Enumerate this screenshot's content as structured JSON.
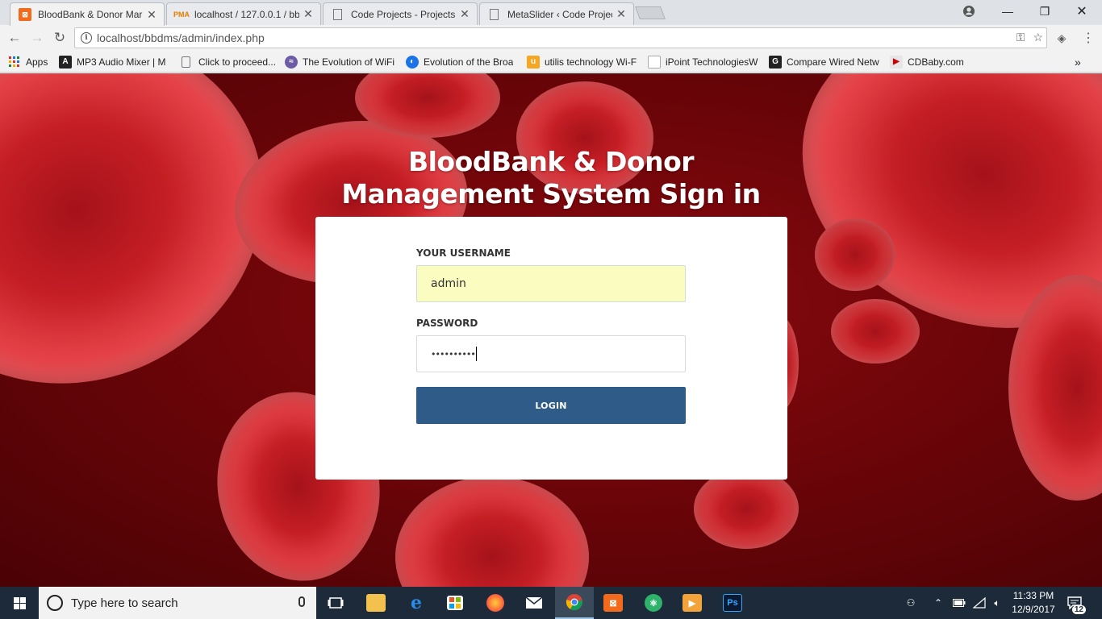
{
  "browser": {
    "tabs": [
      {
        "title": "BloodBank & Donor Mar",
        "favicon": "xampp-icon",
        "active": true
      },
      {
        "title": "localhost / 127.0.0.1 / bb",
        "favicon": "phpmyadmin-icon",
        "active": false
      },
      {
        "title": "Code Projects - Projects,",
        "favicon": "page-icon",
        "active": false
      },
      {
        "title": "MetaSlider ‹ Code Projec",
        "favicon": "page-icon",
        "active": false
      }
    ],
    "address": "localhost/bbdms/admin/index.php",
    "bookmarks": [
      {
        "label": "Apps",
        "icon": "apps-grid-icon"
      },
      {
        "label": "MP3 Audio Mixer | M",
        "icon": "mixer-icon"
      },
      {
        "label": "Click to proceed...",
        "icon": "page-icon"
      },
      {
        "label": "The Evolution of WiFi",
        "icon": "wifi-icon"
      },
      {
        "label": "Evolution of the Broa",
        "icon": "globe-icon"
      },
      {
        "label": "utilis technology Wi-F",
        "icon": "u-icon"
      },
      {
        "label": "iPoint TechnologiesW",
        "icon": "page-icon"
      },
      {
        "label": "Compare Wired Netw",
        "icon": "g-icon"
      },
      {
        "label": "CDBaby.com",
        "icon": "cdbaby-icon"
      }
    ]
  },
  "page": {
    "heading": "BloodBank & Donor Management System Sign in",
    "username_label": "YOUR USERNAME",
    "username_value": "admin",
    "password_label": "PASSWORD",
    "password_value": "••••••••••",
    "login_label": "LOGIN"
  },
  "taskbar": {
    "search_placeholder": "Type here to search",
    "time": "11:33 PM",
    "date": "12/9/2017",
    "notifications": "12",
    "accent": "#9fc3e6"
  }
}
